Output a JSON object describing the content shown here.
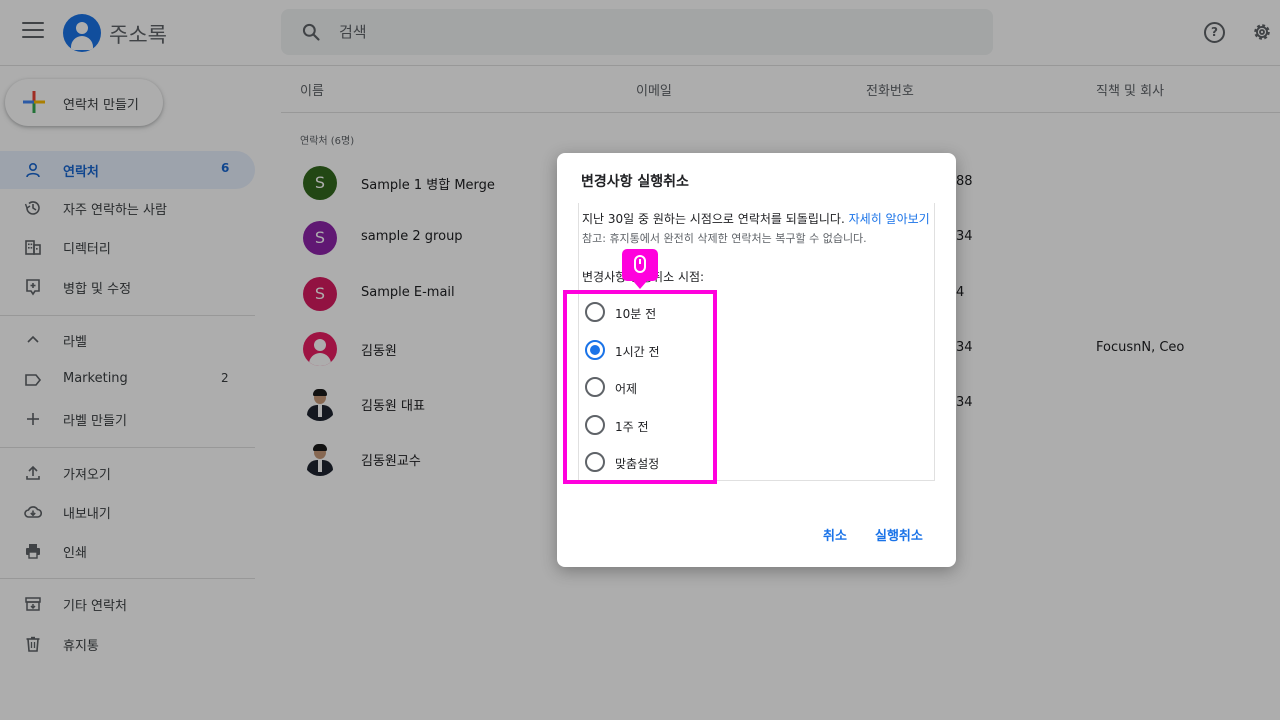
{
  "header": {
    "app_title": "주소록",
    "search_placeholder": "검색"
  },
  "sidebar": {
    "create_label": "연락처 만들기",
    "items": [
      {
        "label": "연락처",
        "count": "6",
        "icon": "person-icon",
        "active": true
      },
      {
        "label": "자주 연락하는 사람",
        "icon": "history-icon"
      },
      {
        "label": "디렉터리",
        "icon": "building-icon"
      },
      {
        "label": "병합 및 수정",
        "icon": "merge-fix-icon"
      }
    ],
    "labels_header": "라벨",
    "labels": [
      {
        "label": "Marketing",
        "count": "2",
        "icon": "label-icon"
      },
      {
        "label": "라벨 만들기",
        "icon": "plus-icon"
      }
    ],
    "actions": [
      {
        "label": "가져오기",
        "icon": "upload-icon"
      },
      {
        "label": "내보내기",
        "icon": "cloud-download-icon"
      },
      {
        "label": "인쇄",
        "icon": "printer-icon"
      }
    ],
    "other": [
      {
        "label": "기타 연락처",
        "icon": "archive-icon"
      },
      {
        "label": "휴지통",
        "icon": "trash-icon"
      }
    ]
  },
  "table": {
    "columns": [
      "이름",
      "이메일",
      "전화번호",
      "직책 및 회사"
    ],
    "section_label": "연락처 (6명)",
    "rows": [
      {
        "name": "Sample 1 병합 Merge",
        "initial": "S",
        "avatar_color": "#33691e",
        "phone": "88",
        "company": ""
      },
      {
        "name": "sample 2 group",
        "initial": "S",
        "avatar_color": "#8e24aa",
        "phone": "34",
        "company": ""
      },
      {
        "name": "Sample E-mail",
        "initial": "S",
        "avatar_color": "#d81b60",
        "phone": "4",
        "company": ""
      },
      {
        "name": "김동원",
        "initial": "",
        "avatar_color": "#e91e63",
        "phone": "34",
        "company": "FocusnN, Ceo"
      },
      {
        "name": "김동원 대표",
        "initial": "",
        "avatar_color": "",
        "phone": "34",
        "company": ""
      },
      {
        "name": "김동원교수",
        "initial": "",
        "avatar_color": "",
        "phone": "",
        "company": ""
      }
    ]
  },
  "dialog": {
    "title": "변경사항 실행취소",
    "description": "지난 30일 중 원하는 시점으로 연락처를 되돌립니다.",
    "learn_more": "자세히 알아보기",
    "note": "참고: 휴지통에서 완전히 삭제한 연락처는 복구할 수 없습니다.",
    "subtitle": "변경사항 실행취소 시점:",
    "options": [
      {
        "label": "10분 전",
        "checked": false
      },
      {
        "label": "1시간 전",
        "checked": true
      },
      {
        "label": "어제",
        "checked": false
      },
      {
        "label": "1주 전",
        "checked": false
      },
      {
        "label": "맞춤설정",
        "checked": false
      }
    ],
    "cancel_label": "취소",
    "confirm_label": "실행취소"
  },
  "colors": {
    "accent": "#1a73e8",
    "highlight": "#ff00dd",
    "active_nav_bg": "#e8f0fe"
  }
}
